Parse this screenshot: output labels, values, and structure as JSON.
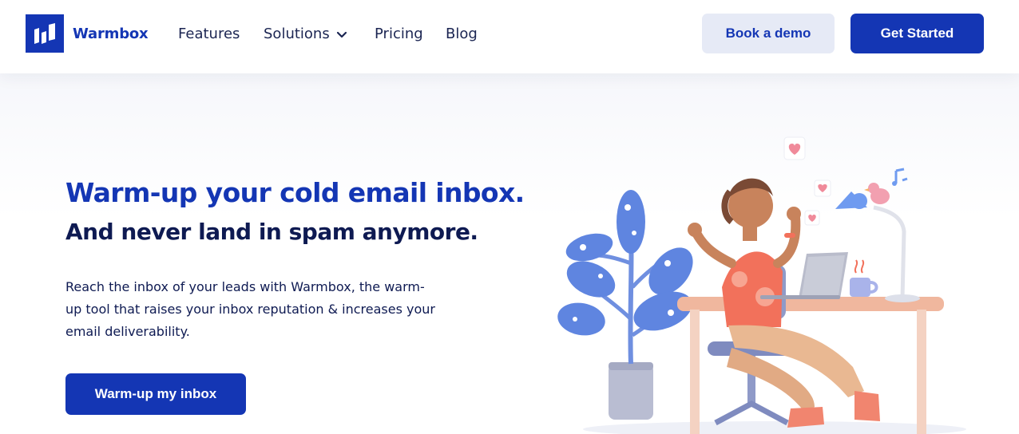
{
  "header": {
    "brand": "Warmbox",
    "nav": {
      "features": "Features",
      "solutions": "Solutions",
      "pricing": "Pricing",
      "blog": "Blog"
    },
    "book_demo": "Book a demo",
    "get_started": "Get Started"
  },
  "hero": {
    "title": "Warm-up your cold email inbox.",
    "subtitle": "And never land in spam anymore.",
    "description": "Reach the inbox of your leads with Warmbox, the warm-up tool that raises your inbox reputation & increases your email deliverability.",
    "cta": "Warm-up my inbox"
  },
  "colors": {
    "brand_blue": "#1436b4",
    "navy_text": "#0e1a52",
    "demo_button_bg": "#e6eaf6"
  },
  "icons": {
    "logo": "warmbox-logo-icon",
    "solutions_dropdown": "chevron-down-icon"
  }
}
